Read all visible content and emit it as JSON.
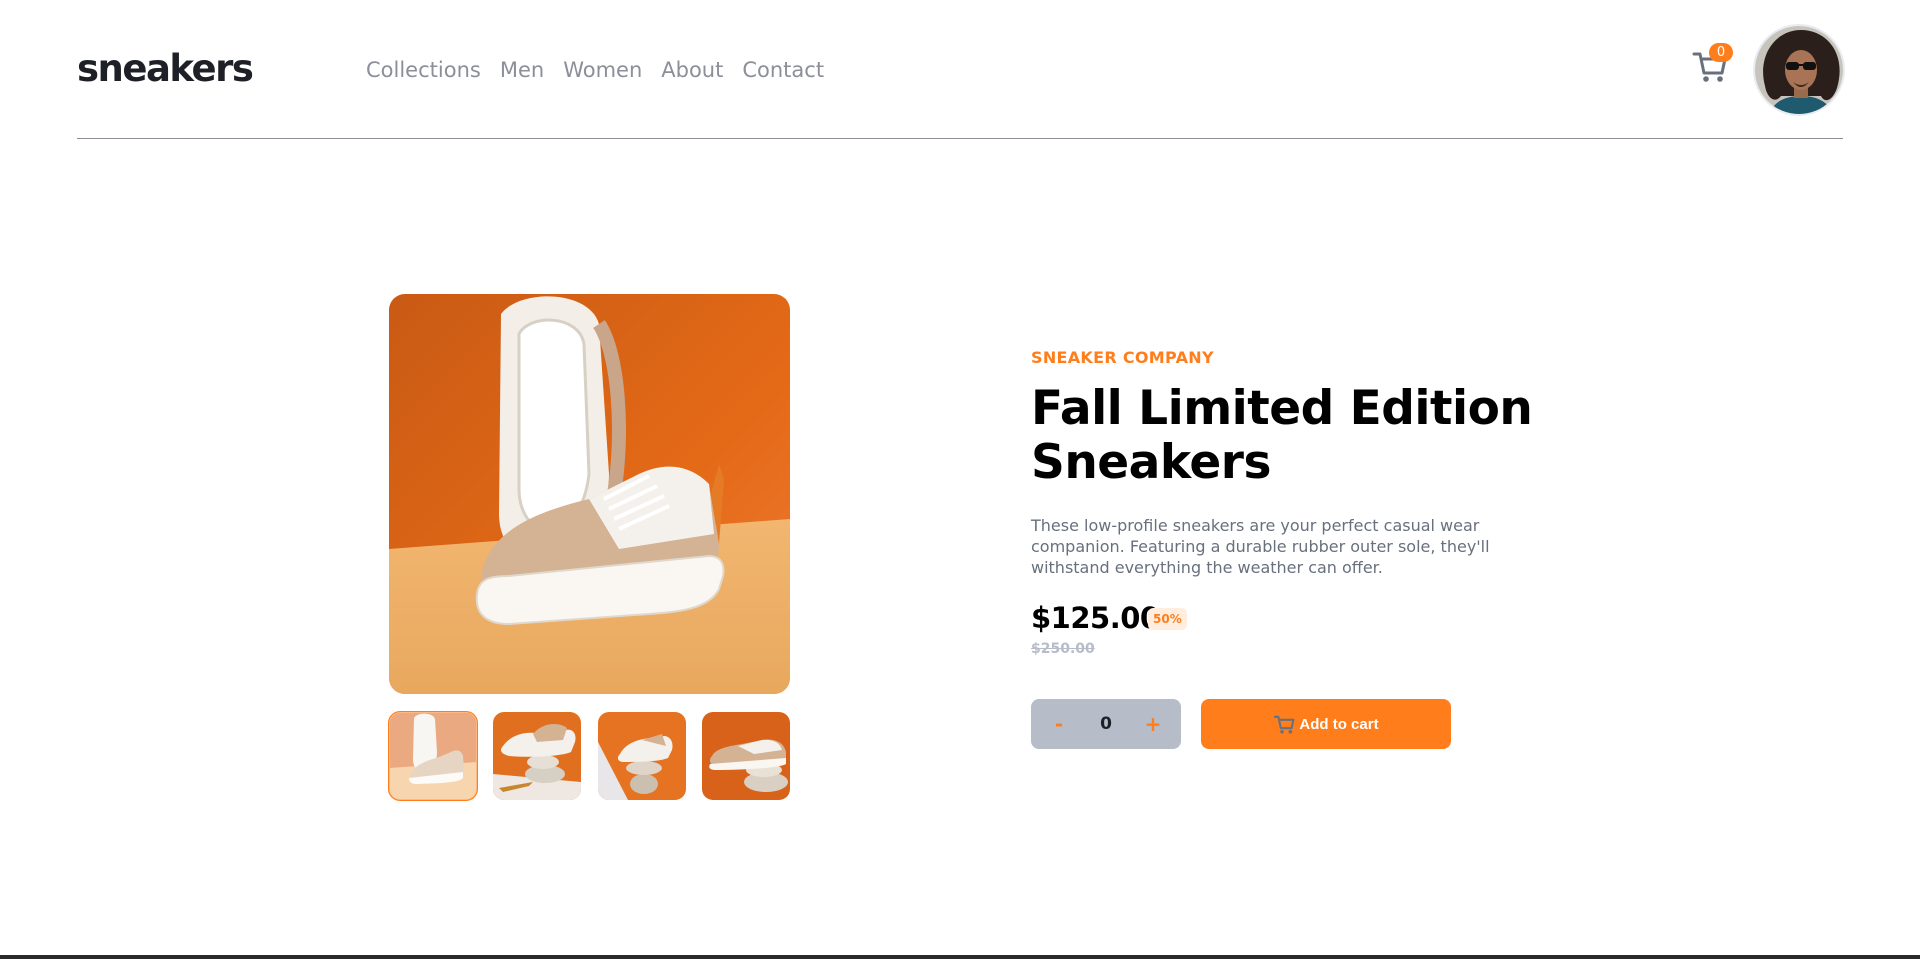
{
  "header": {
    "logo": "sneakers",
    "nav": [
      "Collections",
      "Men",
      "Women",
      "About",
      "Contact"
    ],
    "cart_count": "0"
  },
  "gallery": {
    "thumbnail_count": 4,
    "active_thumbnail": 1
  },
  "product": {
    "company": "SNEAKER COMPANY",
    "title": "Fall Limited Edition Sneakers",
    "description": "These low-profile sneakers are your perfect casual wear companion. Featuring a durable rubber outer sole, they'll withstand everything the weather can offer.",
    "price": "$125.00",
    "discount": "50%",
    "original_price": "$250.00"
  },
  "cart_controls": {
    "minus": "-",
    "quantity": "0",
    "plus": "+",
    "add_label": "Add to cart"
  },
  "colors": {
    "accent": "#ff7e1b",
    "accent_pale": "#ffede0",
    "dark": "#1d2026",
    "grey": "#68707d",
    "grey_light": "#b6bcc8"
  },
  "icons": {
    "cart": "cart-icon",
    "add_cart": "cart-icon"
  }
}
